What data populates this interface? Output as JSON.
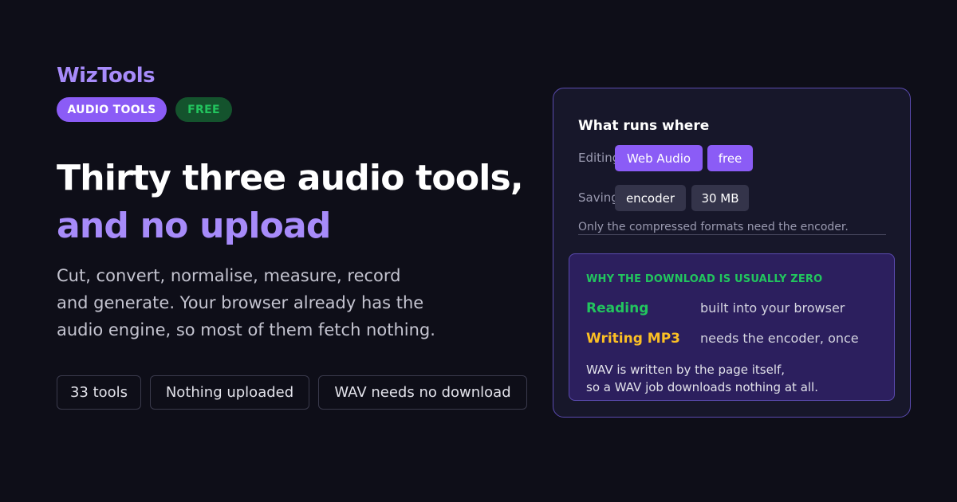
{
  "brand": "WizTools",
  "badges": {
    "category": "AUDIO TOOLS",
    "price": "FREE"
  },
  "headline": {
    "line1": "Thirty three audio tools,",
    "line2": "and no upload"
  },
  "subtitle": {
    "line1": "Cut, convert, normalise, measure, record",
    "line2": "and generate. Your browser already has the",
    "line3": "audio engine, so most of them fetch nothing."
  },
  "chips": [
    "33 tools",
    "Nothing uploaded",
    "WAV needs no download"
  ],
  "card": {
    "title": "What runs where",
    "editing": {
      "label": "Editing",
      "tags": [
        "Web Audio",
        "free"
      ]
    },
    "saving": {
      "label": "Saving",
      "tags": [
        "encoder",
        "30 MB"
      ]
    },
    "note": "Only the compressed formats need the encoder.",
    "inner": {
      "title": "WHY THE DOWNLOAD IS USUALLY ZERO",
      "rows": [
        {
          "label": "Reading",
          "value": "built into your browser"
        },
        {
          "label": "Writing MP3",
          "value": "needs the encoder, once"
        }
      ],
      "footer": {
        "line1": "WAV is written by the page itself,",
        "line2": "so a WAV job downloads nothing at all."
      }
    }
  },
  "colors": {
    "background": "#0e0e18",
    "accent": "#a78bfa",
    "accent_strong": "#8b5cf6",
    "green": "#22c55e",
    "amber": "#fbbf24"
  }
}
